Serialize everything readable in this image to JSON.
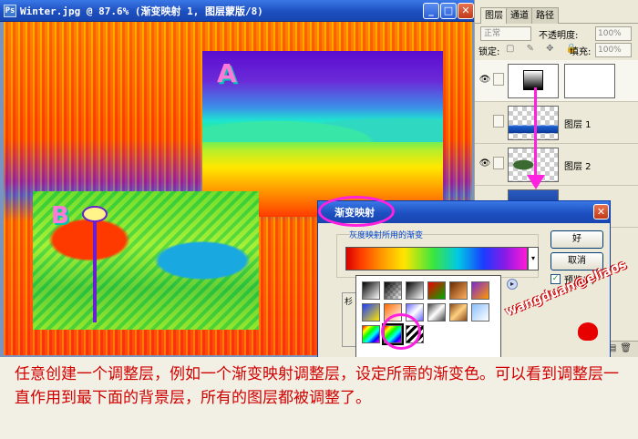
{
  "document": {
    "title": "Winter.jpg @ 87.6% (渐变映射 1, 图层蒙版/8)",
    "icon_label": "Ps",
    "controls": {
      "minimize": "_",
      "maximize": "□",
      "close": "✕"
    },
    "label_a": "A",
    "label_b": "B"
  },
  "layers_panel": {
    "tabs": [
      "图层",
      "通道",
      "路径"
    ],
    "blend_mode": "正常",
    "opacity_label": "不透明度:",
    "opacity_value": "100%",
    "lock_label": "锁定:",
    "fill_label": "填充:",
    "fill_value": "100%",
    "layers": [
      {
        "name": "",
        "visible": true
      },
      {
        "name": "图层 1",
        "visible": false
      },
      {
        "name": "图层 2",
        "visible": true
      },
      {
        "name": "",
        "visible": true
      }
    ],
    "eye_glyph": "👁",
    "bottom_icons": "⊘◐▭✎▤🗑"
  },
  "dialog": {
    "title": "渐变映射",
    "group_label": "灰度映射所用的渐变",
    "ok_label": "好",
    "cancel_label": "取消",
    "preview_label": "预览(P)",
    "preview_checked": "✓",
    "close_glyph": "✕",
    "dropdown_glyph": "▾",
    "side_text": "杉"
  },
  "picker": {
    "arrow_glyph": "▸"
  },
  "watermark": {
    "text": "wangduan@eliaos"
  },
  "caption": "任意创建一个调整层，例如一个渐变映射调整层，设定所需的渐变色。可以看到调整层一直作用到最下面的背景层，所有的图层都被调整了。"
}
